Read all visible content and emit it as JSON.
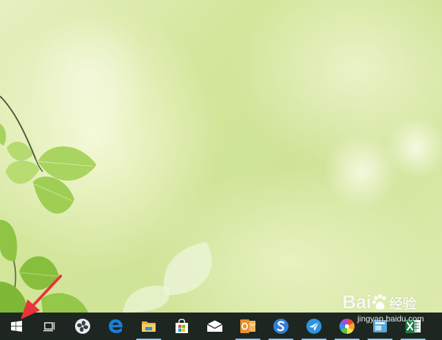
{
  "desktop": {
    "wallpaper": "green-leaves-wallpaper"
  },
  "taskbar": {
    "background": "#1d2620",
    "buttons": [
      {
        "id": "start",
        "icon": "windows-logo-icon"
      },
      {
        "id": "task-view",
        "icon": "task-view-icon"
      },
      {
        "id": "fan-app",
        "icon": "fan-icon"
      },
      {
        "id": "edge",
        "icon": "edge-icon",
        "color": "#1a7fd6"
      },
      {
        "id": "file-explorer",
        "icon": "folder-icon",
        "color": "#f2c14e"
      },
      {
        "id": "store",
        "icon": "store-icon"
      },
      {
        "id": "mail",
        "icon": "mail-icon"
      },
      {
        "id": "outlook",
        "icon": "outlook-icon",
        "color": "#e8912e"
      },
      {
        "id": "sogou",
        "icon": "sogou-icon",
        "color": "#2f7fd8"
      },
      {
        "id": "feather-app",
        "icon": "feather-icon",
        "color": "#2f93e0"
      },
      {
        "id": "color-app",
        "icon": "color-wheel-icon"
      },
      {
        "id": "blue-app",
        "icon": "blue-app-icon"
      },
      {
        "id": "excel",
        "icon": "excel-icon",
        "color": "#1f7a45"
      }
    ]
  },
  "watermark": {
    "logo": "Bai",
    "logo_tail": "经验",
    "subtitle": "jingyan.baidu.com"
  },
  "annotation": {
    "arrow_color": "#e8333a"
  }
}
